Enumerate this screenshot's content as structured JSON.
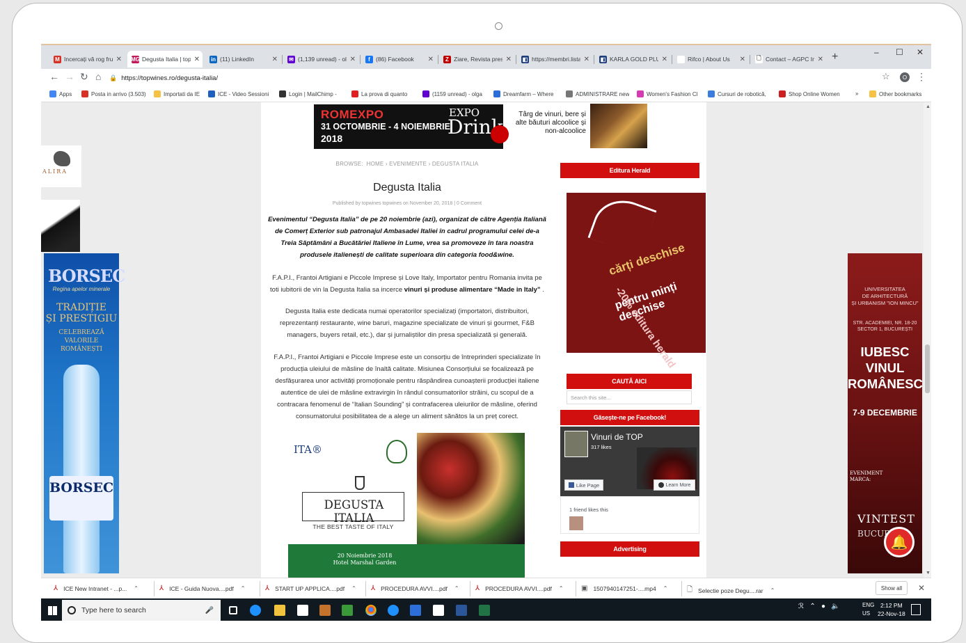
{
  "browser": {
    "tabs": [
      {
        "title": "Incercați vă rog fru",
        "icon": "gmail-icon",
        "color": "#d93025",
        "glyph": "M"
      },
      {
        "title": "Degusta Italia | top",
        "icon": "mg-icon",
        "color": "#c2185b",
        "glyph": "MG",
        "active": true
      },
      {
        "title": "(11) LinkedIn",
        "icon": "linkedin-icon",
        "color": "#0a66c2",
        "glyph": "in"
      },
      {
        "title": "(1,139 unread) - oly",
        "icon": "yahoo-mail-icon",
        "color": "#6001d2",
        "glyph": "✉"
      },
      {
        "title": "(86) Facebook",
        "icon": "facebook-icon",
        "color": "#1877f2",
        "glyph": "f"
      },
      {
        "title": "Ziare, Revista prese",
        "icon": "z-icon",
        "color": "#c00000",
        "glyph": "Z"
      },
      {
        "title": "https://membri.lista",
        "icon": "doc-icon",
        "color": "#1f3f7a",
        "glyph": "◧"
      },
      {
        "title": "KARLA GOLD PLUS",
        "icon": "doc-icon",
        "color": "#1f3f7a",
        "glyph": "◧"
      },
      {
        "title": "Rifco | About Us",
        "icon": "blank-icon",
        "color": "#ffffff",
        "glyph": ""
      },
      {
        "title": "Contact – AGPC Im",
        "icon": "page-icon",
        "color": "#ffffff",
        "glyph": "🗋"
      }
    ],
    "url": "https://topwines.ro/degusta-italia/",
    "bookmarks": [
      {
        "label": "Apps",
        "color": "#4285f4"
      },
      {
        "label": "Posta in arrivo (3.503)",
        "color": "#d93025"
      },
      {
        "label": "Importati da IE",
        "color": "#f6c244"
      },
      {
        "label": "ICE - Video Sessioni",
        "color": "#1f5fbf"
      },
      {
        "label": "Login | MailChimp -",
        "color": "#333333"
      },
      {
        "label": "La prova di quanto",
        "color": "#e02020"
      },
      {
        "label": "(1159 unread) - olga",
        "color": "#6001d2"
      },
      {
        "label": "Dreamfarm – Where",
        "color": "#2a6ed9"
      },
      {
        "label": "ADMINISTRARE new",
        "color": "#777777"
      },
      {
        "label": "Women's Fashion Cl",
        "color": "#d63bb5"
      },
      {
        "label": "Cursuri de robotică,",
        "color": "#3b7ddd"
      },
      {
        "label": "Shop Online Women",
        "color": "#cc2020"
      }
    ],
    "bookmarks_more": "»",
    "other_bookmarks": "Other bookmarks",
    "avatar_letter": "O"
  },
  "page": {
    "top_ad": {
      "romexpo": "ROMEXPO",
      "dates": "31 OCTOMBRIE - 4 NOIEMBRIE",
      "year": "2018",
      "expo": "EXPO",
      "drink": "Drink",
      "tagline": "Târg de vinuri, bere și alte băuturi alcoolice și non-alcoolice"
    },
    "breadcrumb": {
      "browse": "BROWSE:",
      "home": "HOME",
      "sep": "›",
      "section": "EVENIMENTE",
      "current": "DEGUSTA ITALIA"
    },
    "title": "Degusta Italia",
    "byline": "Published by topwines topwines on November 20, 2018 | 0 Comment",
    "intro": "Evenimentul “Degusta Italia” de pe 20 noiembrie (azi), organizat de către Agenția Italiană de Comerț Exterior sub patronajul Ambasadei Italiei în cadrul programului celei de-a Treia Săptămâni a Bucătăriei Italiene în Lume, vrea sa promoveze în tara noastra produsele italienești de calitate superioara din categoria food&wine.",
    "p1_start": "F.A.P.I., Frantoi Artigiani e Piccole Imprese și Love Italy, Importator pentru Romania invita pe toti iubitorii de vin la Degusta Italia sa incerce ",
    "p1_bold": "vinuri și produse alimentare “Made in Italy”",
    "p1_end": " .",
    "p2": "Degusta Italia este dedicata numai operatorilor specializați (importatori, distribuitori, reprezentanți restaurante, wine baruri, magazine specializate de vinuri și gourmet, F&B managers, buyers retail, etc.), dar și jurnaliștilor din presa specializată și generală.",
    "p3": "F.A.P.I., Frantoi Artigiani e Piccole Imprese este un consorțiu de întreprinderi specializate în producția uleiului de măsline de înaltă calitate. Misiunea Consorțiului se focalizează pe desfășurarea unor activități promoționale pentru răspândirea cunoașterii producției italiene autentice de ulei de măsline extravirgin în rândul consumatorilor străini, cu scopul de a contracara fenomenul de “Italian Sounding” și contrafacerea uleiurilor de măsline, oferind consumatorului posibilitatea de a alege un aliment sănătos la un preț corect.",
    "poster": {
      "ita": "ITA®",
      "title": "DEGUSTA ITALIA",
      "subtitle": "THE BEST TASTE OF ITALY",
      "date_line1": "20 Noiembrie 2018",
      "date_line2": "Hotel Marshal Garden"
    },
    "sidebar": {
      "editura_header": "Editura Herald",
      "book_ad": {
        "line1": "cărți deschise",
        "line2": "pentru minți deschise",
        "line3": "-20% editura herald"
      },
      "search_header": "CAUTĂ AICI",
      "search_placeholder": "Search this site...",
      "facebook_header": "Găsește-ne pe Facebook!",
      "fb_page_name": "Vinuri de TOP",
      "fb_likes": "317 likes",
      "fb_like_button": "Like Page",
      "fb_learn_more": "Learn More",
      "fb_friends": "1 friend likes this",
      "advertising_header": "Advertising"
    },
    "left_ads": {
      "alira": "ALIRA",
      "borsec_brand": "BORSEC",
      "borsec_tag": "Regina apelor minerale",
      "borsec_line1": "TRADIȚIE",
      "borsec_line2": "ȘI PRESTIGIU",
      "borsec_line3": "CELEBREAZĂ",
      "borsec_line4": "VALORILE",
      "borsec_line5": "ROMÂNEȘTI",
      "borsec_label": "BORSEC"
    },
    "right_ad": {
      "univ1": "UNIVERSITATEA",
      "univ2": "DE ARHITECTURĂ",
      "univ3": "ȘI URBANISM \"ION MINCU\"",
      "addr1": "STR. ACADEMIEI, NR. 18-20",
      "addr2": "SECTOR 1, BUCUREȘTI",
      "slogan1": "IUBESC",
      "slogan2": "VINUL",
      "slogan3": "ROMÂNESC",
      "dates": "7-9 DECEMBRIE",
      "event1": "EVENIMENT",
      "event2": "MARCA:",
      "brand": "VINTEST",
      "city": "BUCUR"
    }
  },
  "downloads": [
    {
      "name": "ICE New Intranet - ...p..."
    },
    {
      "name": "ICE - Guida Nuova....pdf"
    },
    {
      "name": "START UP APPLICA....pdf"
    },
    {
      "name": "PROCEDURA AVVI....pdf"
    },
    {
      "name": "PROCEDURA AVVI....pdf"
    },
    {
      "name": "1507940147251-....mp4"
    },
    {
      "name": "Selectie poze Degu....rar"
    }
  ],
  "downloads_show_all": "Show all",
  "taskbar": {
    "search_placeholder": "Type here to search",
    "lang1": "ENG",
    "lang2": "US",
    "time": "2:12 PM",
    "date": "22-Nov-18"
  }
}
